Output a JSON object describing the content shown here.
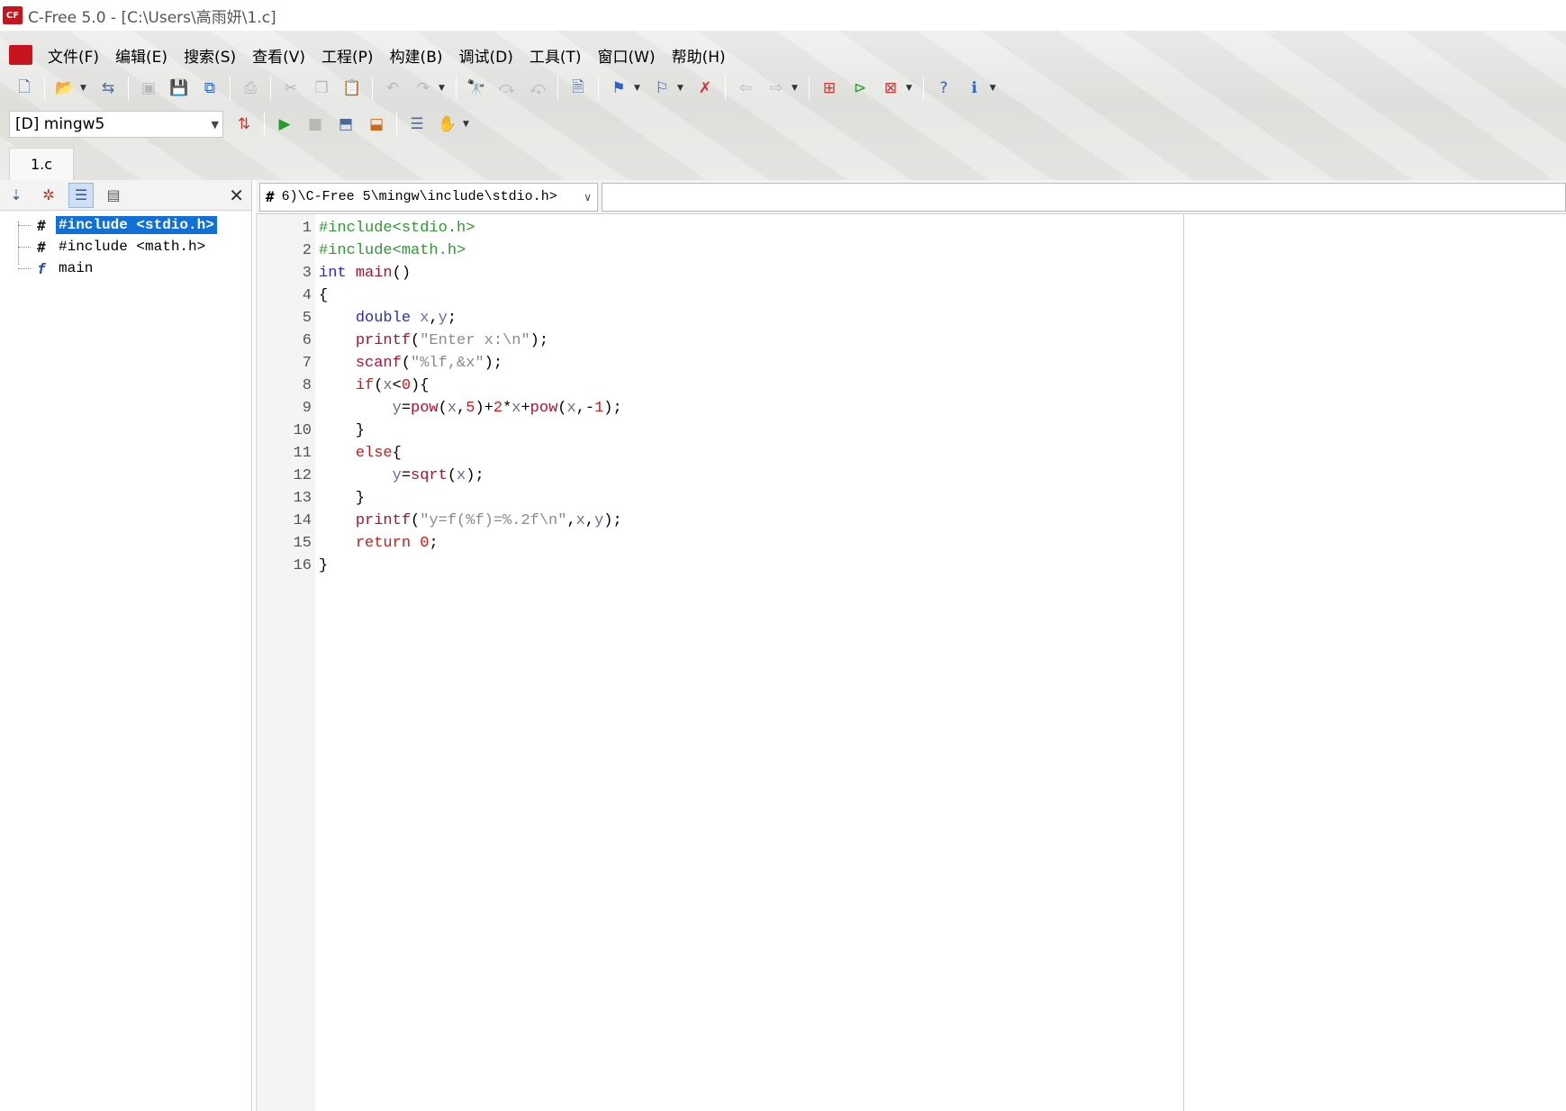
{
  "window": {
    "title": "C-Free 5.0 - [C:\\Users\\高雨妍\\1.c]",
    "logo_icon": "cfree-logo-icon"
  },
  "menu": [
    {
      "label": "文件(F)"
    },
    {
      "label": "编辑(E)"
    },
    {
      "label": "搜索(S)"
    },
    {
      "label": "查看(V)"
    },
    {
      "label": "工程(P)"
    },
    {
      "label": "构建(B)"
    },
    {
      "label": "调试(D)"
    },
    {
      "label": "工具(T)"
    },
    {
      "label": "窗口(W)"
    },
    {
      "label": "帮助(H)"
    }
  ],
  "toolbar": {
    "compiler_select": "[D] mingw5"
  },
  "tabs": [
    {
      "label": "1.c"
    }
  ],
  "outline": {
    "items": [
      {
        "icon": "#",
        "label": "#include <stdio.h>",
        "selected": true
      },
      {
        "icon": "#",
        "label": "#include <math.h>",
        "selected": false
      },
      {
        "icon": "f",
        "label": "main",
        "selected": false
      }
    ]
  },
  "editor": {
    "include_combo": "6)\\C-Free 5\\mingw\\include\\stdio.h>",
    "lines": [
      {
        "n": "1",
        "text": "#include<stdio.h>"
      },
      {
        "n": "2",
        "text": "#include<math.h>"
      },
      {
        "n": "3",
        "text": "int main()"
      },
      {
        "n": "4",
        "text": "{"
      },
      {
        "n": "5",
        "text": "    double x,y;"
      },
      {
        "n": "6",
        "text": "    printf(\"Enter x:\\n\");"
      },
      {
        "n": "7",
        "text": "    scanf(\"%lf,&x\");"
      },
      {
        "n": "8",
        "text": "    if(x<0){"
      },
      {
        "n": "9",
        "text": "        y=pow(x,5)+2*x+pow(x,-1);"
      },
      {
        "n": "10",
        "text": "    }"
      },
      {
        "n": "11",
        "text": "    else{"
      },
      {
        "n": "12",
        "text": "        y=sqrt(x);"
      },
      {
        "n": "13",
        "text": "    }"
      },
      {
        "n": "14",
        "text": "    printf(\"y=f(%f)=%.2f\\n\",x,y);"
      },
      {
        "n": "15",
        "text": "    return 0;"
      },
      {
        "n": "16",
        "text": "}"
      }
    ]
  },
  "colors": {
    "preprocessor": "#2e9a2e",
    "keyword_type": "#2b2bcc",
    "keyword_flow": "#c81e1e",
    "selection": "#1170d8"
  }
}
